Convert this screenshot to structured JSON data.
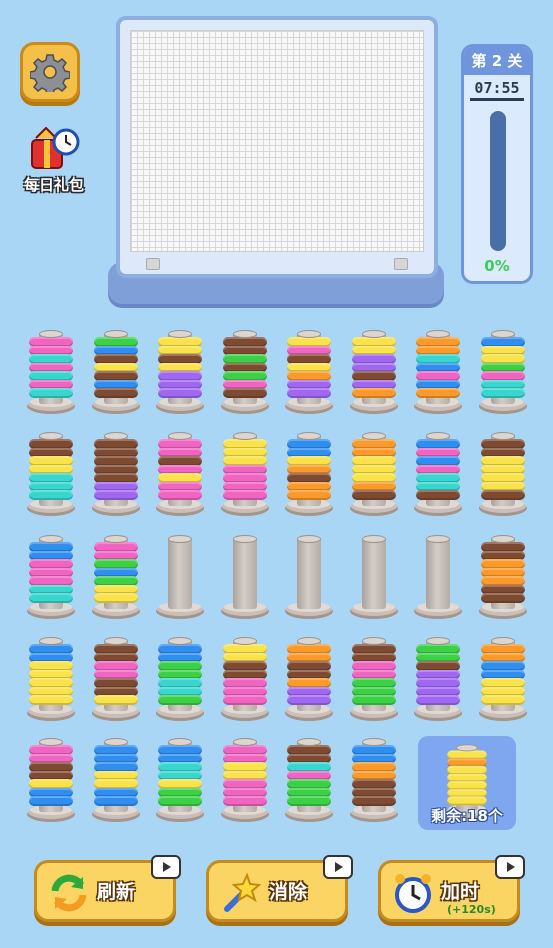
{
  "top": {
    "daily_gift_label": "每日礼包"
  },
  "level_panel": {
    "title": "第 2 关",
    "timer": "07:55",
    "progress_percent": 0,
    "progress_label": "0%"
  },
  "pegs": {
    "colors": {
      "p": "#f165c2",
      "y": "#f9e24a",
      "b": "#2f8ef0",
      "c": "#39d6d0",
      "g": "#3bd046",
      "o": "#fb9a2a",
      "br": "#7e4a32",
      "v": "#a067f0"
    },
    "rows": [
      [
        [
          "p",
          "p",
          "c",
          "p",
          "c",
          "p",
          "c"
        ],
        [
          "g",
          "b",
          "br",
          "y",
          "br",
          "b",
          "br"
        ],
        [
          "y",
          "y",
          "br",
          "y",
          "v",
          "v",
          "v"
        ],
        [
          "br",
          "br",
          "g",
          "br",
          "g",
          "p",
          "br"
        ],
        [
          "y",
          "p",
          "br",
          "y",
          "o",
          "v",
          "v"
        ],
        [
          "y",
          "y",
          "v",
          "v",
          "br",
          "v",
          "o"
        ],
        [
          "o",
          "o",
          "c",
          "b",
          "p",
          "b",
          "o"
        ],
        [
          "b",
          "y",
          "y",
          "g",
          "p",
          "c",
          "c"
        ]
      ],
      [
        [
          "br",
          "br",
          "y",
          "y",
          "c",
          "c",
          "c"
        ],
        [
          "br",
          "br",
          "br",
          "br",
          "br",
          "v",
          "v"
        ],
        [
          "p",
          "p",
          "br",
          "p",
          "y",
          "p",
          "p"
        ],
        [
          "y",
          "y",
          "y",
          "p",
          "p",
          "p",
          "p"
        ],
        [
          "b",
          "b",
          "y",
          "o",
          "br",
          "o",
          "o"
        ],
        [
          "o",
          "o",
          "y",
          "y",
          "y",
          "o",
          "br"
        ],
        [
          "b",
          "p",
          "b",
          "p",
          "c",
          "c",
          "br"
        ],
        [
          "br",
          "br",
          "y",
          "y",
          "y",
          "y",
          "br"
        ]
      ],
      [
        [
          "b",
          "b",
          "p",
          "p",
          "p",
          "c",
          "c"
        ],
        [
          "p",
          "p",
          "g",
          "b",
          "g",
          "y",
          "y"
        ],
        [],
        [],
        [],
        [],
        [],
        [
          "br",
          "br",
          "o",
          "o",
          "o",
          "br",
          "br"
        ]
      ],
      [
        [
          "b",
          "b",
          "y",
          "y",
          "y",
          "y",
          "y"
        ],
        [
          "br",
          "br",
          "p",
          "p",
          "br",
          "br",
          "y"
        ],
        [
          "b",
          "b",
          "g",
          "g",
          "c",
          "c",
          "g"
        ],
        [
          "y",
          "y",
          "br",
          "br",
          "p",
          "p",
          "p"
        ],
        [
          "o",
          "o",
          "br",
          "br",
          "o",
          "v",
          "v"
        ],
        [
          "br",
          "br",
          "p",
          "p",
          "g",
          "g",
          "g"
        ],
        [
          "g",
          "g",
          "br",
          "v",
          "v",
          "v",
          "v"
        ],
        [
          "o",
          "o",
          "b",
          "b",
          "y",
          "y",
          "y"
        ]
      ],
      [
        [
          "p",
          "p",
          "br",
          "br",
          "y",
          "b",
          "b"
        ],
        [
          "b",
          "b",
          "b",
          "y",
          "y",
          "b",
          "b"
        ],
        [
          "b",
          "b",
          "c",
          "c",
          "y",
          "g",
          "g"
        ],
        [
          "p",
          "p",
          "y",
          "y",
          "p",
          "p",
          "p"
        ],
        [
          "br",
          "br",
          "c",
          "p",
          "g",
          "g",
          "g"
        ],
        [
          "b",
          "b",
          "o",
          "o",
          "br",
          "br",
          "br"
        ]
      ]
    ]
  },
  "remaining": {
    "label": "剩余:18个",
    "preview_rings": [
      "y",
      "o",
      "y",
      "y",
      "y",
      "y",
      "y"
    ]
  },
  "actions": {
    "refresh_label": "刷新",
    "eliminate_label": "消除",
    "add_time_label": "加时",
    "add_time_sub": "(+120s)"
  }
}
